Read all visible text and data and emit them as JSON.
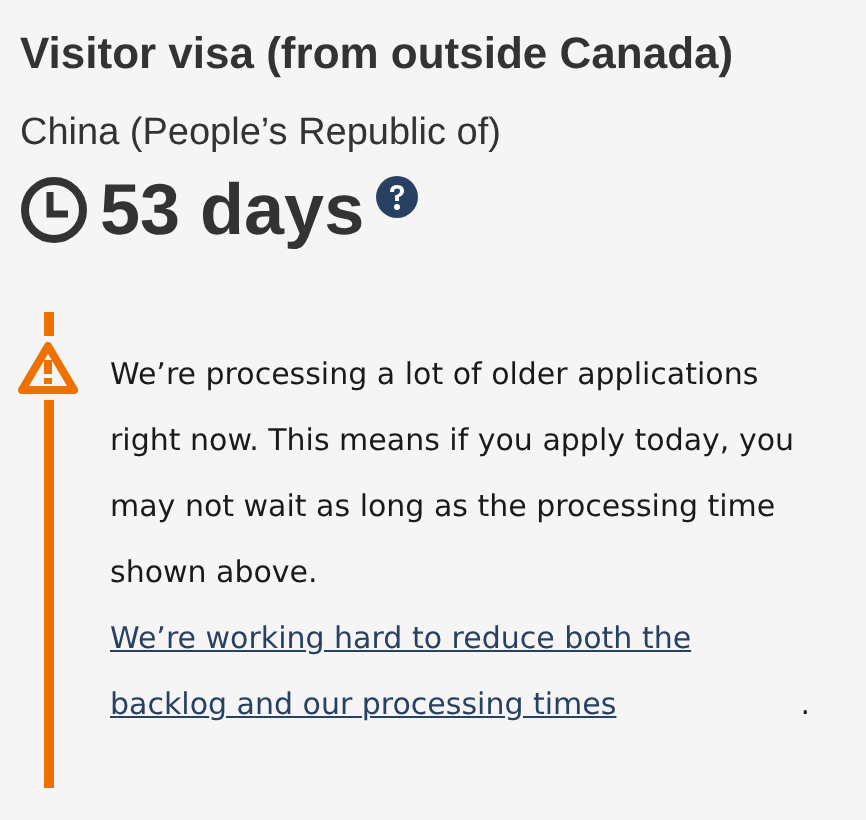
{
  "heading": "Visitor visa (from outside Canada)",
  "country": "China (People’s Republic of)",
  "processing_time": "53 days",
  "alert": {
    "text": "We’re processing a lot of older applications right now. This means if you apply today, you may not wait as long as the processing time shown above. ",
    "link": "We’re working hard to reduce both the backlog and our processing times",
    "after": "."
  }
}
